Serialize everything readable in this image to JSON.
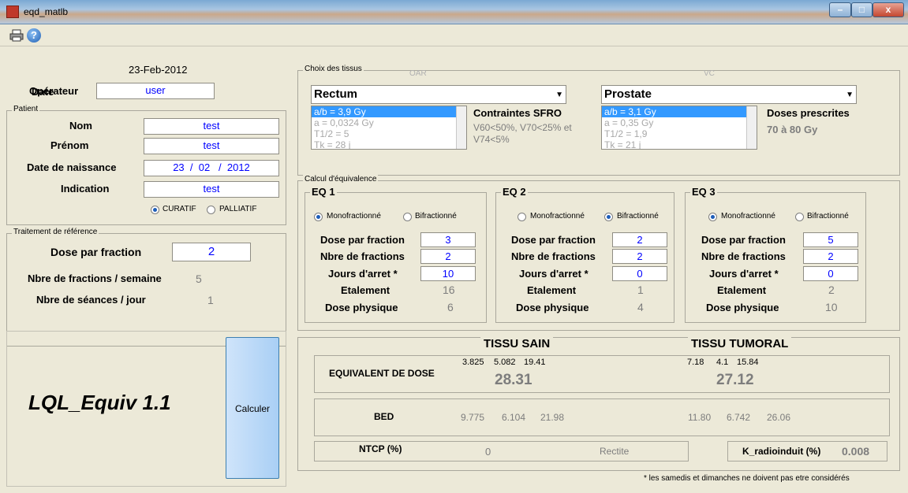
{
  "window": {
    "title": "eqd_matlb",
    "btn_min": "–",
    "btn_max": "□",
    "btn_close": "x",
    "help": "?"
  },
  "icons": {
    "print": "printer-icon",
    "help": "help-icon"
  },
  "header": {
    "date_label": "Date",
    "date_value": "23-Feb-2012",
    "operator_label": "Opérateur",
    "operator_value": "user"
  },
  "patient": {
    "group": "Patient",
    "nom_label": "Nom",
    "nom": "test",
    "prenom_label": "Prénom",
    "prenom": "test",
    "naissance_label": "Date de naissance",
    "naissance": "23  /  02   /  2012",
    "indication_label": "Indication",
    "indication": "test",
    "curatif": "CURATIF",
    "palliatif": "PALLIATIF"
  },
  "reference": {
    "group": "Traitement de référence",
    "dose_label": "Dose par fraction",
    "dose": "2",
    "fractions_semaine_label": "Nbre de fractions / semaine",
    "fractions_semaine": "5",
    "seances_label": "Nbre de séances / jour",
    "seances": "1"
  },
  "tissus": {
    "group": "Choix des tissus",
    "oar": {
      "header": "OAR",
      "selected": "Rectum",
      "list": [
        "a/b = 3,9 Gy",
        "a = 0,0324 Gy",
        "T1/2 = 5",
        "Tk = 28 j"
      ],
      "info_title": "Contraintes SFRO",
      "info_text_1": "V60<50%, V70<25% et",
      "info_text_2": "V74<5%"
    },
    "vc": {
      "header": "VC",
      "selected": "Prostate",
      "list": [
        "a/b = 3,1 Gy",
        "a = 0,35 Gy",
        "T1/2 = 1,9",
        "Tk = 21 j"
      ],
      "info_title": "Doses prescrites",
      "info_text_1": "70 à 80 Gy"
    }
  },
  "calcul": {
    "group": "Calcul d'équivalence",
    "mono": "Monofractionné",
    "bi": "Bifractionné",
    "dose_label": "Dose par fraction",
    "nbre_label": "Nbre de fractions",
    "jours_label": "Jours d'arret *",
    "etalement_label": "Etalement",
    "physique_label": "Dose physique",
    "eq": [
      {
        "title": "EQ 1",
        "dose": "3",
        "nbre": "2",
        "jours": "10",
        "etalement": "16",
        "physique": "6"
      },
      {
        "title": "EQ 2",
        "dose": "2",
        "nbre": "2",
        "jours": "0",
        "etalement": "1",
        "physique": "4"
      },
      {
        "title": "EQ 3",
        "dose": "5",
        "nbre": "2",
        "jours": "0",
        "etalement": "2",
        "physique": "10"
      }
    ]
  },
  "app_name": "LQL_Equiv 1.1",
  "calculer": "Calculer",
  "results": {
    "tissu_sain": "TISSU SAIN",
    "tissu_tumoral": "TISSU TUMORAL",
    "equiv_label": "EQUIVALENT DE DOSE",
    "sain_eq": [
      "3.825",
      "5.082",
      "19.41"
    ],
    "sain_total": "28.31",
    "tum_eq": [
      "7.18",
      "4.1",
      "15.84"
    ],
    "tum_total": "27.12",
    "bed_label": "BED",
    "sain_bed": [
      "9.775",
      "6.104",
      "21.98"
    ],
    "tum_bed": [
      "11.80",
      "6.742",
      "26.06"
    ],
    "ntcp_label": "NTCP (%)",
    "ntcp": "0",
    "rectite": "Rectite",
    "k_label": "K_radioinduit (%)",
    "k": "0.008"
  },
  "footnote": "* les samedis et dimanches ne doivent pas etre considérés"
}
